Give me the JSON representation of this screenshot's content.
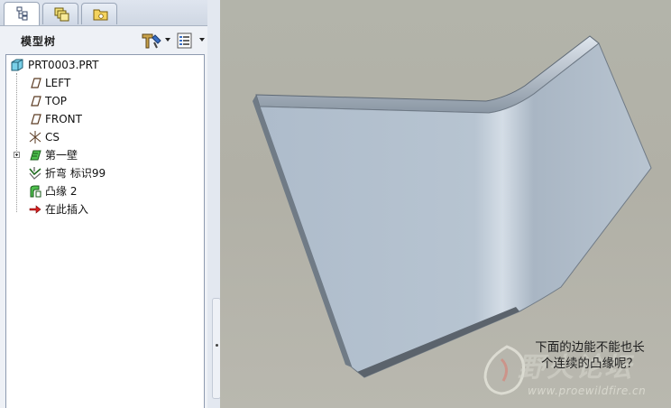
{
  "panel": {
    "title": "模型树",
    "tabs": [
      {
        "name": "model-tree-tab",
        "icon": "model-tree-icon",
        "active": true
      },
      {
        "name": "layers-tab",
        "icon": "layers-icon",
        "active": false
      },
      {
        "name": "folder-browser-tab",
        "icon": "folder-icon",
        "active": false
      }
    ],
    "settings_icon": "tree-settings-icon",
    "show_icon": "show-options-icon"
  },
  "tree": {
    "items": [
      {
        "label": "PRT0003.PRT",
        "icon": "part-icon"
      },
      {
        "label": "LEFT",
        "icon": "datum-plane-icon"
      },
      {
        "label": "TOP",
        "icon": "datum-plane-icon"
      },
      {
        "label": "FRONT",
        "icon": "datum-plane-icon"
      },
      {
        "label": "CS",
        "icon": "coordinate-system-icon"
      },
      {
        "label": "第一壁",
        "icon": "first-wall-icon"
      },
      {
        "label": "折弯 标识99",
        "icon": "bend-icon"
      },
      {
        "label": "凸缘 2",
        "icon": "flange-icon"
      },
      {
        "label": "在此插入",
        "icon": "insert-here-arrow-icon"
      }
    ]
  },
  "viewport": {
    "caption_line1": "下面的边能不能也长",
    "caption_line2": "个连续的凸缘呢？",
    "watermark_text": "野火论坛",
    "watermark_url": "www.proewildfire.cn",
    "colors": {
      "background": "#b2b1a7",
      "part": "#b9c6d3",
      "part_edge": "#6f7a86"
    }
  }
}
